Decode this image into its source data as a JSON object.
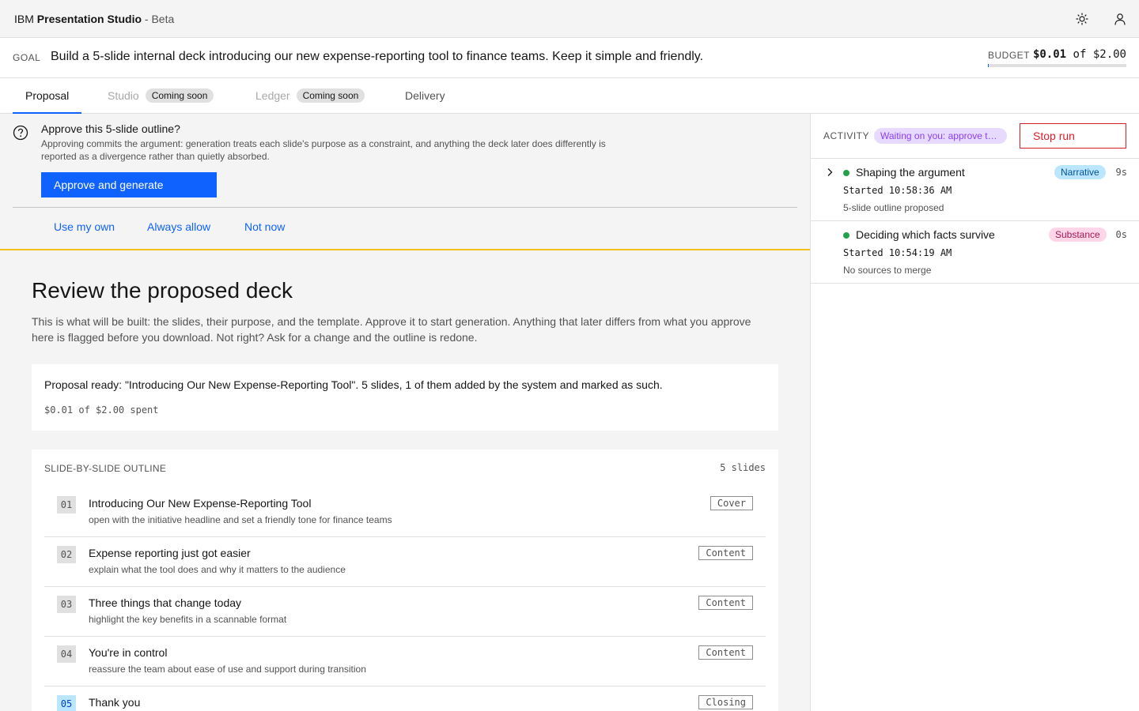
{
  "header": {
    "brand_prefix": "IBM",
    "brand_name": "Presentation Studio",
    "brand_suffix": "- Beta",
    "icons": [
      "theme-icon",
      "user-icon"
    ]
  },
  "goal": {
    "label": "GOAL",
    "text": "Build a 5-slide internal deck introducing our new expense-reporting tool to finance teams. Keep it simple and friendly."
  },
  "budget": {
    "label": "BUDGET",
    "spent": "$0.01",
    "of": "of",
    "total": "$2.00",
    "progress": 0.005
  },
  "tabs": [
    {
      "label": "Proposal",
      "state": "active"
    },
    {
      "label": "Studio",
      "state": "disabled",
      "badge": "Coming soon"
    },
    {
      "label": "Ledger",
      "state": "disabled",
      "badge": "Coming soon"
    },
    {
      "label": "Delivery",
      "state": "normal"
    }
  ],
  "approval": {
    "title": "Approve this 5-slide outline?",
    "description": "Approving commits the argument: generation treats each slide's purpose as a constraint, and anything the deck later does differently is reported as a divergence rather than quietly absorbed.",
    "primary_button": "Approve and generate",
    "links": [
      "Use my own",
      "Always allow",
      "Not now"
    ]
  },
  "review": {
    "heading": "Review the proposed deck",
    "intro": "This is what will be built: the slides, their purpose, and the template. Approve it to start generation. Anything that later differs from what you approve here is flagged before you download. Not right? Ask for a change and the outline is redone."
  },
  "proposal_card": {
    "text": "Proposal ready: \"Introducing Our New Expense-Reporting Tool\". 5 slides, 1 of them added by the system and marked as such.",
    "spent": "$0.01 of $2.00 spent"
  },
  "outline": {
    "label": "SLIDE-BY-SLIDE OUTLINE",
    "count": "5 slides",
    "slides": [
      {
        "num": "01",
        "title": "Introducing Our New Expense-Reporting Tool",
        "purpose": "open with the initiative headline and set a friendly tone for finance teams",
        "type": "Cover"
      },
      {
        "num": "02",
        "title": "Expense reporting just got easier",
        "purpose": "explain what the tool does and why it matters to the audience",
        "type": "Content"
      },
      {
        "num": "03",
        "title": "Three things that change today",
        "purpose": "highlight the key benefits in a scannable format",
        "type": "Content"
      },
      {
        "num": "04",
        "title": "You're in control",
        "purpose": "reassure the team about ease of use and support during transition",
        "type": "Content"
      },
      {
        "num": "05",
        "title": "Thank you",
        "purpose": "",
        "type": "Closing"
      }
    ]
  },
  "activity": {
    "label": "ACTIVITY",
    "status": "Waiting on you: approve the outline",
    "stop_button": "Stop run",
    "items": [
      {
        "title": "Shaping the argument",
        "tag": "Narrative",
        "duration": "9s",
        "started": "Started 10:58:36 AM",
        "note": "5-slide outline proposed"
      },
      {
        "title": "Deciding which facts survive",
        "tag": "Substance",
        "duration": "0s",
        "started": "Started 10:54:19 AM",
        "note": "No sources to merge"
      }
    ]
  }
}
